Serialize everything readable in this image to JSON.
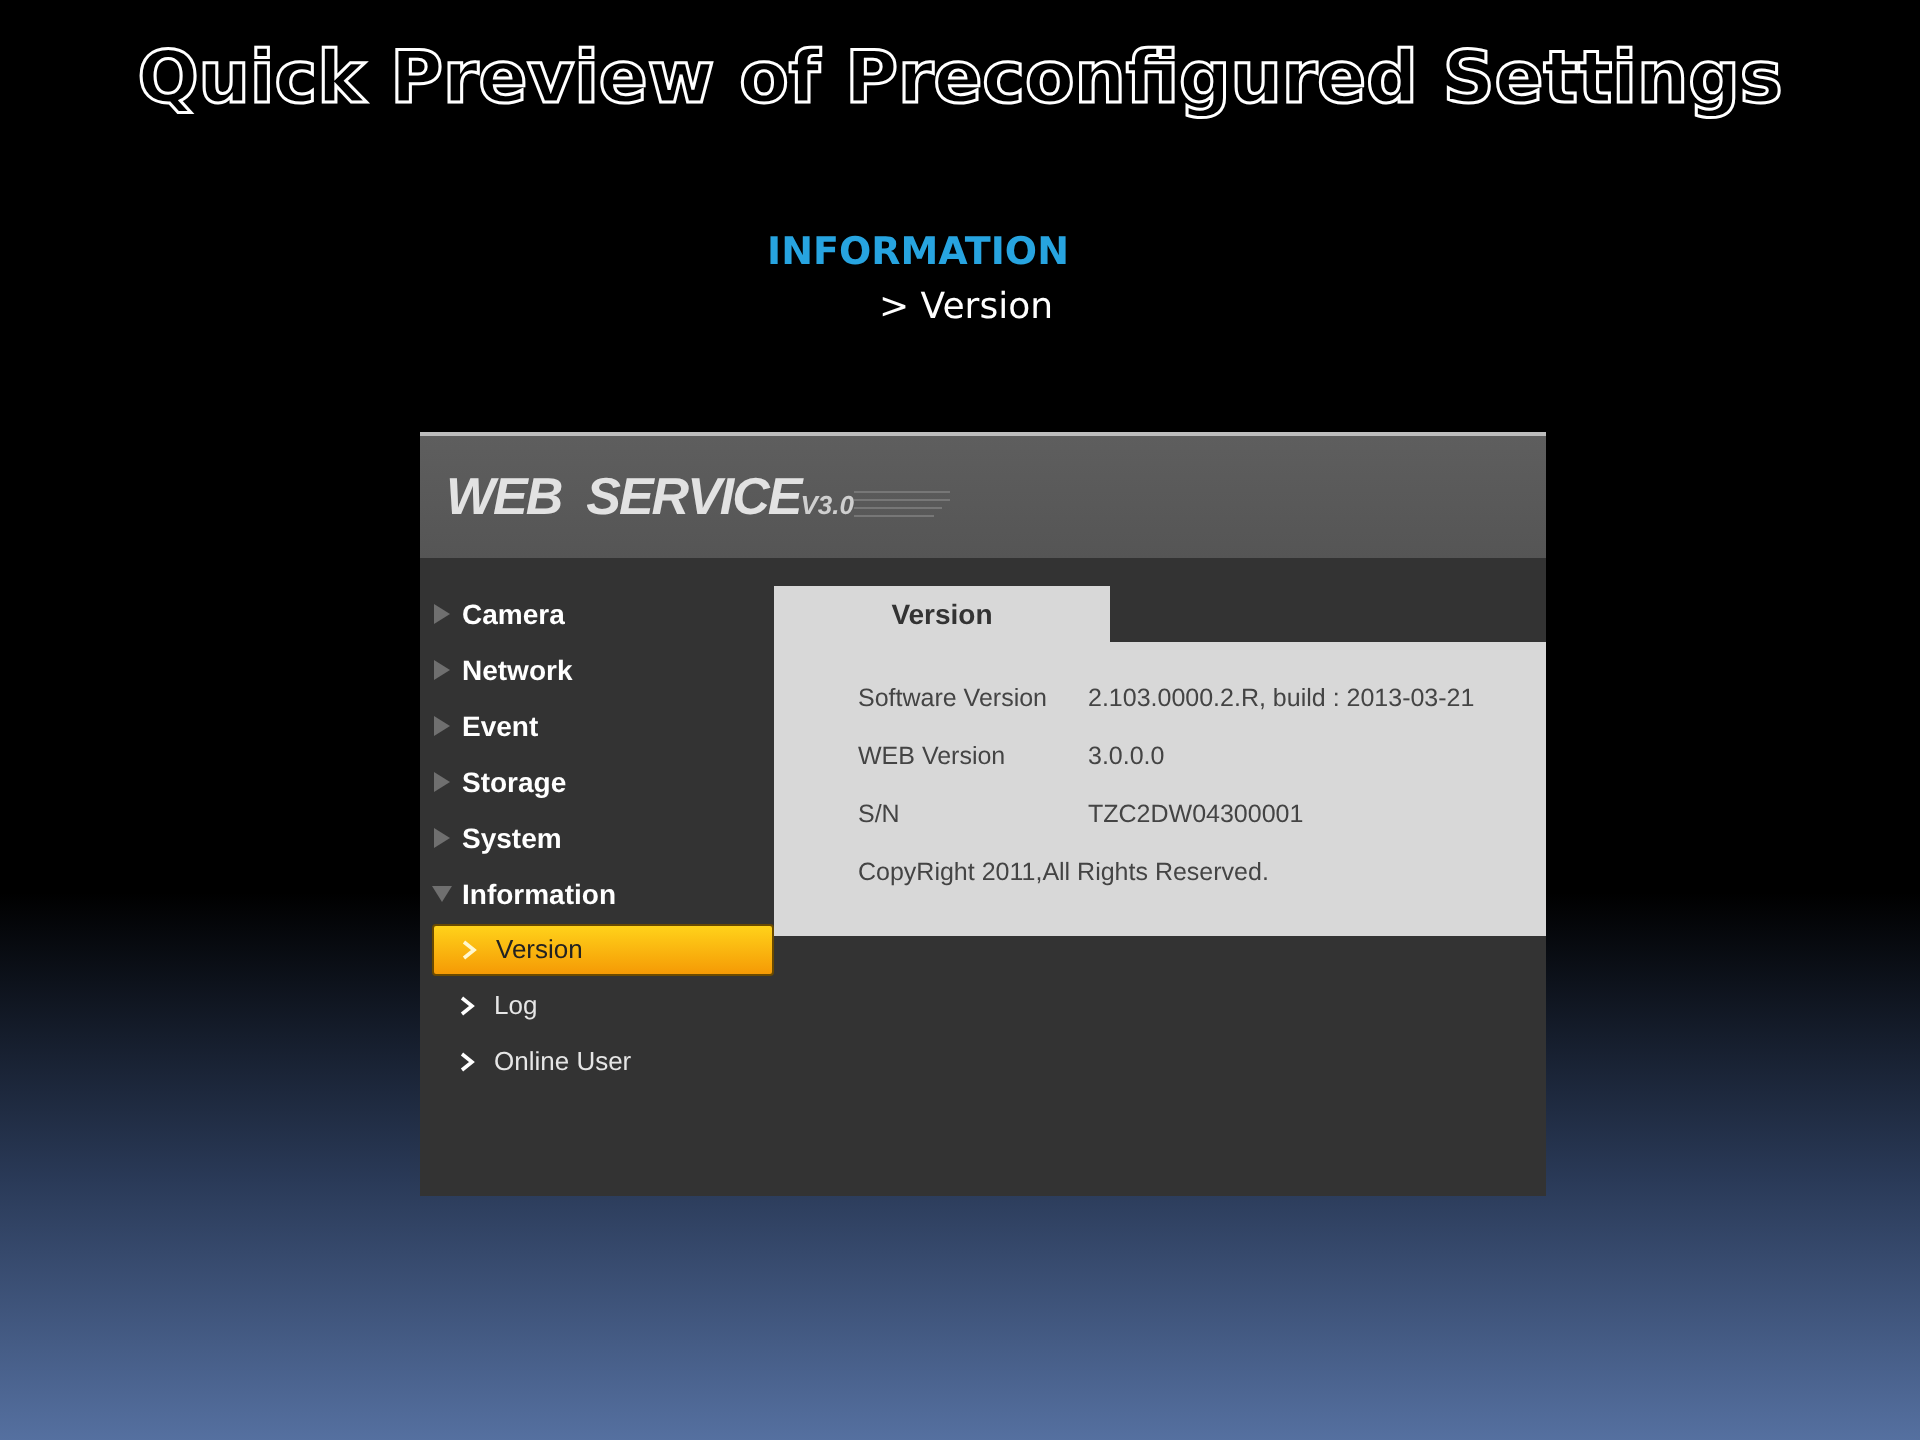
{
  "slide": {
    "title": "Quick Preview of Preconfigured Settings",
    "section": "INFORMATION",
    "breadcrumb": "> Version"
  },
  "app": {
    "logo": "WEB  SERVICE",
    "logo_version": "V3.0",
    "menu": [
      {
        "label": "Camera",
        "expanded": false
      },
      {
        "label": "Network",
        "expanded": false
      },
      {
        "label": "Event",
        "expanded": false
      },
      {
        "label": "Storage",
        "expanded": false
      },
      {
        "label": "System",
        "expanded": false
      },
      {
        "label": "Information",
        "expanded": true,
        "children": [
          {
            "label": "Version",
            "selected": true
          },
          {
            "label": "Log",
            "selected": false
          },
          {
            "label": "Online User",
            "selected": false
          }
        ]
      }
    ],
    "tabs": [
      {
        "label": "Version",
        "selected": true
      }
    ],
    "fields": [
      {
        "label": "Software Version",
        "value": "2.103.0000.2.R, build : 2013-03-21"
      },
      {
        "label": "WEB Version",
        "value": "3.0.0.0"
      },
      {
        "label": "S/N",
        "value": "TZC2DW04300001"
      }
    ],
    "copyright": "CopyRight 2011,All Rights Reserved."
  }
}
